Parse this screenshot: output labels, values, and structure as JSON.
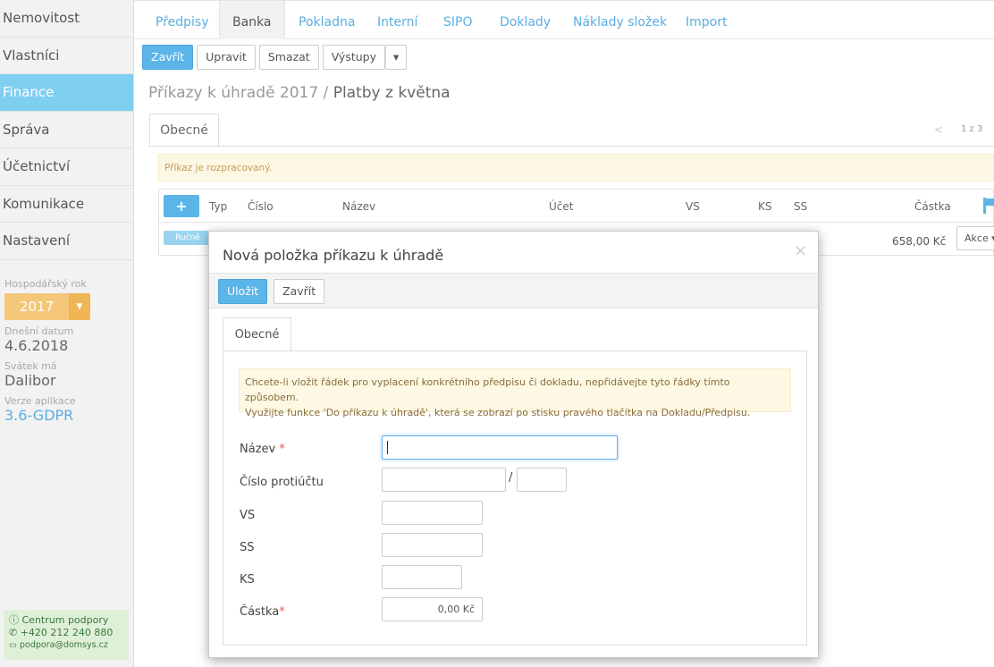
{
  "sidebar": {
    "items": [
      {
        "label": "Nemovitost"
      },
      {
        "label": "Vlastníci"
      },
      {
        "label": "Finance"
      },
      {
        "label": "Správa"
      },
      {
        "label": "Účetnictví"
      },
      {
        "label": "Komunikace"
      },
      {
        "label": "Nastavení"
      }
    ],
    "active_index": 2,
    "fiscal_year_label": "Hospodářský rok",
    "fiscal_year_value": "2017",
    "today_label": "Dnešní datum",
    "today_value": "4.6.2018",
    "nameday_label": "Svátek má",
    "nameday_value": "Dalibor",
    "version_label": "Verze aplikace",
    "version_value": "3.6-GDPR",
    "support": {
      "title": "Centrum podpory",
      "phone": "+420 212 240 880",
      "email": "podpora@domsys.cz"
    }
  },
  "topnav": {
    "tabs": [
      {
        "label": "Předpisy"
      },
      {
        "label": "Banka"
      },
      {
        "label": "Pokladna"
      },
      {
        "label": "Interní"
      },
      {
        "label": "SIPO"
      },
      {
        "label": "Doklady"
      },
      {
        "label": "Náklady složek"
      },
      {
        "label": "Import"
      }
    ],
    "active": "Banka"
  },
  "toolbar": {
    "close_label": "Zavřít",
    "edit_label": "Upravit",
    "delete_label": "Smazat",
    "outputs_label": "Výstupy"
  },
  "page": {
    "title_parent": "Příkazy k úhradě 2017",
    "title_sep": " / ",
    "title_current": "Platby z května",
    "tab_label": "Obecné",
    "pager": "1 z 3",
    "status_alert": "Příkaz je rozpracovaný."
  },
  "table": {
    "columns": {
      "typ": "Typ",
      "cislo": "Číslo",
      "nazev": "Název",
      "ucet": "Účet",
      "vs": "VS",
      "ks": "KS",
      "ss": "SS",
      "castka": "Částka"
    },
    "add_label": "+",
    "rows": [
      {
        "type_badge": "Ručně",
        "amount": "658,00 Kč",
        "actions_label": "Akce"
      }
    ]
  },
  "modal": {
    "title": "Nová položka příkazu k úhradě",
    "save_label": "Uložit",
    "close_label": "Zavřít",
    "tab_label": "Obecné",
    "info_line1": "Chcete-li vložit řádek pro vyplacení konkrétního předpisu či dokladu, nepřidávejte tyto řádky tímto způsobem.",
    "info_line2": "Využijte funkce 'Do příkazu k úhradě', která se zobrazí po stisku pravého tlačítka na Dokladu/Předpisu.",
    "fields": {
      "name_label": "Název",
      "account_label": "Číslo protiúčtu",
      "account_sep": "/",
      "vs_label": "VS",
      "ss_label": "SS",
      "ks_label": "KS",
      "amount_label": "Částka",
      "amount_value": "0,00 Kč",
      "required_mark": "*"
    }
  }
}
